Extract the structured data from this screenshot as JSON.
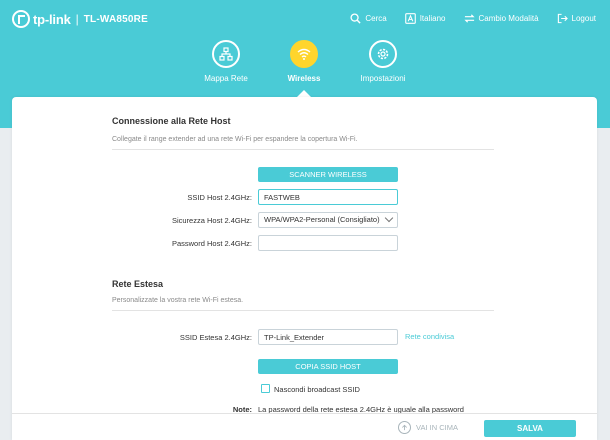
{
  "header": {
    "brand": "tp-link",
    "separator": "|",
    "model": "TL-WA850RE",
    "nav": {
      "search": "Cerca",
      "language": "Italiano",
      "mode": "Cambio Modalità",
      "logout": "Logout"
    },
    "tabs": [
      {
        "label": "Mappa Rete",
        "icon": "network-map-icon"
      },
      {
        "label": "Wireless",
        "icon": "wifi-icon",
        "active": true
      },
      {
        "label": "Impostazioni",
        "icon": "settings-gear-icon"
      }
    ]
  },
  "host_section": {
    "title": "Connessione alla Rete Host",
    "description": "Collegate il range extender ad una rete Wi-Fi per espandere la copertura Wi-Fi.",
    "scan_button": "SCANNER WIRELESS",
    "ssid_label": "SSID Host 2.4GHz:",
    "ssid_value": "FASTWEB",
    "security_label": "Sicurezza Host 2.4GHz:",
    "security_value": "WPA/WPA2-Personal (Consigliato)",
    "password_label": "Password Host 2.4GHz:",
    "password_value": ""
  },
  "extended_section": {
    "title": "Rete Estesa",
    "description": "Personalizzate la vostra rete Wi-Fi estesa.",
    "ssid_label": "SSID Estesa 2.4GHz:",
    "ssid_value": "TP-Link_Extender",
    "share_link": "Rete condivisa",
    "copy_button": "COPIA SSID HOST",
    "hide_ssid_label": "Nascondi broadcast SSID",
    "hide_ssid_checked": false,
    "note_label": "Note:",
    "note_text": "La password della rete estesa 2.4GHz è uguale alla password"
  },
  "footer": {
    "back_to_top": "VAI IN CIMA",
    "save": "SALVA"
  },
  "colors": {
    "accent": "#4acbd6",
    "active_tab": "#ffd52c",
    "background": "#e9edf0"
  }
}
